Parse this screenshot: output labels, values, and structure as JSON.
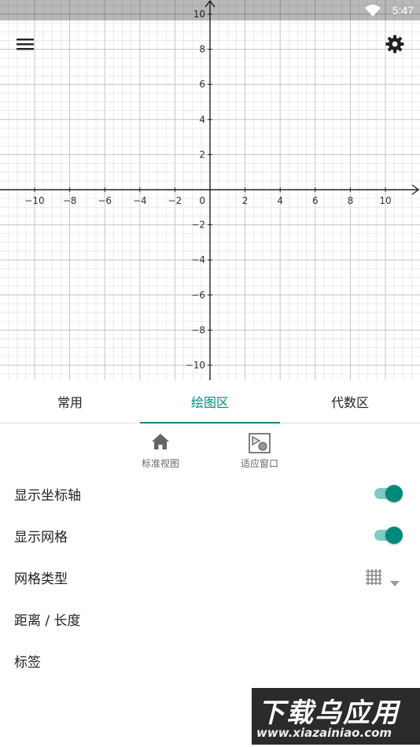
{
  "status_bar": {
    "time": "5:47",
    "icons": [
      "wifi-icon"
    ]
  },
  "graph": {
    "x_range": [
      -12,
      12
    ],
    "y_range": [
      -11,
      11
    ],
    "x_tick_labels": [
      -10,
      -8,
      -6,
      -4,
      -2,
      2,
      4,
      6,
      8,
      10
    ],
    "y_tick_labels": [
      10,
      8,
      6,
      4,
      2,
      -2,
      -4,
      -6,
      -8,
      -10
    ],
    "origin_label": "0",
    "grid": true
  },
  "toolbar": {
    "menu_icon": "menu-icon",
    "settings_icon": "settings-icon"
  },
  "tabs": [
    {
      "label": "常用",
      "active": false
    },
    {
      "label": "绘图区",
      "active": true
    },
    {
      "label": "代数区",
      "active": false
    }
  ],
  "view_buttons": [
    {
      "label": "标准视图",
      "icon": "home-icon"
    },
    {
      "label": "适应窗口",
      "icon": "fit-window-icon"
    }
  ],
  "settings": {
    "show_axes": {
      "label": "显示坐标轴",
      "on": true
    },
    "show_grid": {
      "label": "显示网格",
      "on": true
    },
    "grid_type": {
      "label": "网格类型",
      "icon": "grid-icon"
    },
    "distance": {
      "label": "距离 / 长度"
    },
    "labels": {
      "label": "标签"
    }
  },
  "watermark": {
    "line1": "下载乌应用",
    "line2": "www.xiazainiao.com"
  },
  "colors": {
    "accent": "#00897b",
    "accent_light": "#80cbc4",
    "grid_minor": "#e6e6e6",
    "grid_major": "#c4c4c4"
  }
}
